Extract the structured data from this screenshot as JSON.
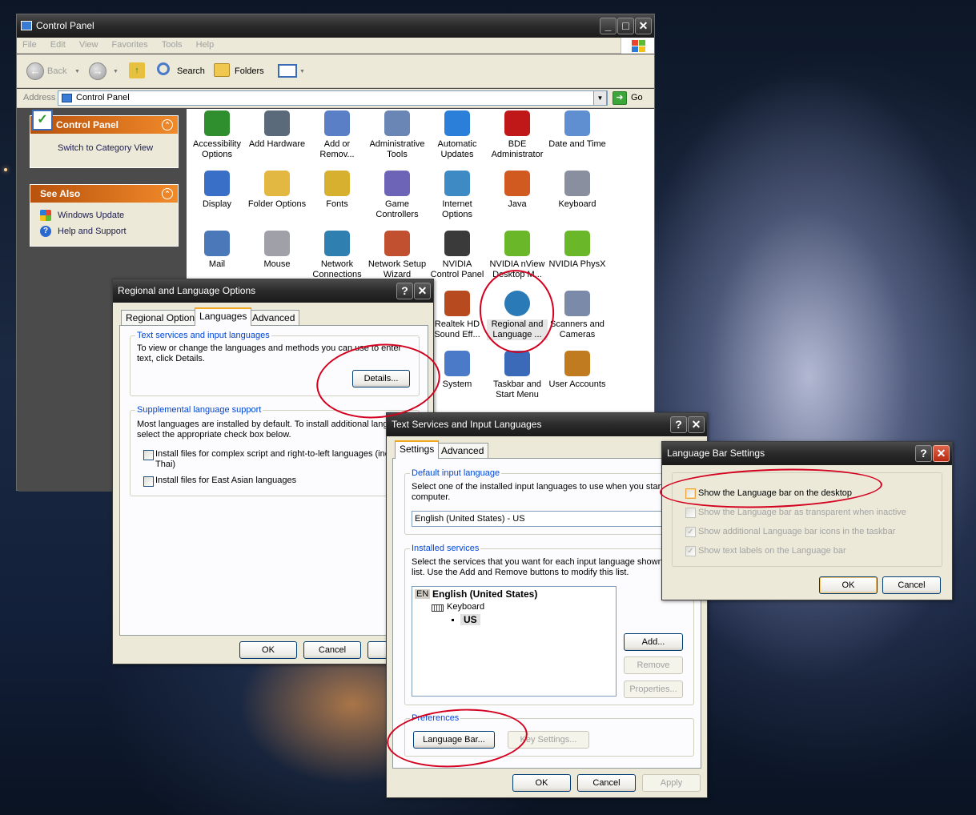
{
  "control_panel": {
    "title": "Control Panel",
    "menu": [
      "File",
      "Edit",
      "View",
      "Favorites",
      "Tools",
      "Help"
    ],
    "toolbar": {
      "back": "Back",
      "search": "Search",
      "folders": "Folders"
    },
    "address": {
      "label": "Address",
      "value": "Control Panel",
      "go": "Go"
    },
    "left_panel": {
      "control_panel_header": "Control Panel",
      "switch_link": "Switch to Category View",
      "see_also_header": "See Also",
      "see_also_links": [
        "Windows Update",
        "Help and Support"
      ]
    },
    "items": [
      {
        "line1": "Accessibility",
        "line2": "Options",
        "icon": "accessibility-icon",
        "color": "#2f8f2f"
      },
      {
        "line1": "Add Hardware",
        "line2": "",
        "icon": "add-hardware-icon",
        "color": "#5a6a7a"
      },
      {
        "line1": "Add or",
        "line2": "Remov...",
        "icon": "add-remove-programs-icon",
        "color": "#5b7fc6"
      },
      {
        "line1": "Administrative",
        "line2": "Tools",
        "icon": "administrative-tools-icon",
        "color": "#6a86b5"
      },
      {
        "line1": "Automatic",
        "line2": "Updates",
        "icon": "automatic-updates-icon",
        "color": "#2b7fd8"
      },
      {
        "line1": "BDE",
        "line2": "Administrator",
        "icon": "bde-administrator-icon",
        "color": "#c01818"
      },
      {
        "line1": "Date and Time",
        "line2": "",
        "icon": "date-time-icon",
        "color": "#5f8fd0"
      },
      {
        "line1": "Display",
        "line2": "",
        "icon": "display-icon",
        "color": "#3a6fc8"
      },
      {
        "line1": "Folder Options",
        "line2": "",
        "icon": "folder-options-icon",
        "color": "#e3b842"
      },
      {
        "line1": "Fonts",
        "line2": "",
        "icon": "fonts-icon",
        "color": "#d8b030"
      },
      {
        "line1": "Game",
        "line2": "Controllers",
        "icon": "game-controllers-icon",
        "color": "#6d64b8"
      },
      {
        "line1": "Internet",
        "line2": "Options",
        "icon": "internet-options-icon",
        "color": "#3d8ac4"
      },
      {
        "line1": "Java",
        "line2": "",
        "icon": "java-icon",
        "color": "#d05a20"
      },
      {
        "line1": "Keyboard",
        "line2": "",
        "icon": "keyboard-icon",
        "color": "#8a8fa0"
      },
      {
        "line1": "Mail",
        "line2": "",
        "icon": "mail-icon",
        "color": "#4a78b8"
      },
      {
        "line1": "Mouse",
        "line2": "",
        "icon": "mouse-icon",
        "color": "#a0a0a8"
      },
      {
        "line1": "Network",
        "line2": "Connections",
        "icon": "network-connections-icon",
        "color": "#2f7fb0"
      },
      {
        "line1": "Network Setup",
        "line2": "Wizard",
        "icon": "network-setup-wizard-icon",
        "color": "#c05030"
      },
      {
        "line1": "NVIDIA",
        "line2": "Control Panel",
        "icon": "nvidia-control-panel-icon",
        "color": "#3a3a3a"
      },
      {
        "line1": "NVIDIA nView",
        "line2": "Desktop M...",
        "icon": "nvidia-nview-icon",
        "color": "#6ab82a"
      },
      {
        "line1": "NVIDIA PhysX",
        "line2": "",
        "icon": "nvidia-physx-icon",
        "color": "#6ab82a"
      },
      {
        "line1": "Realtek HD",
        "line2": "Sound Eff...",
        "icon": "realtek-sound-icon",
        "color": "#b84a20"
      },
      {
        "line1": "Regional and",
        "line2": "Language ...",
        "icon": "regional-language-icon",
        "color": "#2a7ab8"
      },
      {
        "line1": "Scanners and",
        "line2": "Cameras",
        "icon": "scanners-cameras-icon",
        "color": "#7a8aa8"
      },
      {
        "line1": "System",
        "line2": "",
        "icon": "system-icon",
        "color": "#4a7ac8"
      },
      {
        "line1": "Taskbar and",
        "line2": "Start Menu",
        "icon": "taskbar-start-menu-icon",
        "color": "#3a6ab8"
      },
      {
        "line1": "User Accounts",
        "line2": "",
        "icon": "user-accounts-icon",
        "color": "#c07a20"
      }
    ]
  },
  "regional": {
    "title": "Regional and Language Options",
    "tabs": [
      "Regional Options",
      "Languages",
      "Advanced"
    ],
    "text_services": {
      "title": "Text services and input languages",
      "desc1": "To view or change the languages and methods you can use to enter",
      "desc2": "text, click Details.",
      "details": "Details..."
    },
    "supplemental": {
      "title": "Supplemental language support",
      "desc1": "Most languages are installed by default. To install additional langua",
      "desc2": "select the appropriate check box below.",
      "check1_line1": "Install files for complex script and right-to-left languages (incluc",
      "check1_line2": "Thai)",
      "check2": "Install files for East Asian languages"
    },
    "ok": "OK",
    "cancel": "Cancel"
  },
  "text_services": {
    "title": "Text Services and Input Languages",
    "tabs": [
      "Settings",
      "Advanced"
    ],
    "default_input": {
      "title": "Default input language",
      "desc1": "Select one of the installed input languages to use when you start y",
      "desc2": "computer.",
      "value": "English (United States) - US"
    },
    "installed": {
      "title": "Installed services",
      "desc1": "Select the services that you want for each input language shown i",
      "desc2": "list. Use the Add and Remove buttons to modify this list.",
      "lang_code": "EN",
      "language": "English (United States)",
      "keyboard": "Keyboard",
      "layout": "US",
      "add": "Add...",
      "remove": "Remove",
      "properties": "Properties..."
    },
    "preferences": {
      "title": "Preferences",
      "language_bar": "Language Bar...",
      "key_settings": "Key Settings..."
    },
    "ok": "OK",
    "cancel": "Cancel",
    "apply": "Apply"
  },
  "language_bar": {
    "title": "Language Bar Settings",
    "options": [
      {
        "label": "Show the Language bar on the desktop",
        "checked": false,
        "enabled": true
      },
      {
        "label": "Show the Language bar as transparent when inactive",
        "checked": false,
        "enabled": false
      },
      {
        "label": "Show additional Language bar icons in the taskbar",
        "checked": true,
        "enabled": false
      },
      {
        "label": "Show text labels on the Language bar",
        "checked": true,
        "enabled": false
      }
    ],
    "ok": "OK",
    "cancel": "Cancel"
  },
  "annotation_color": "#d3001f"
}
